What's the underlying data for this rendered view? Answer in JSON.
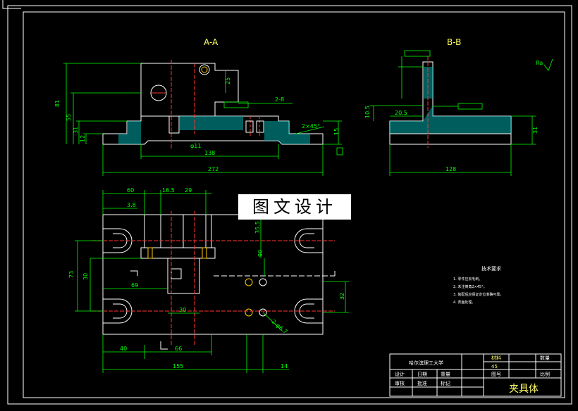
{
  "views": {
    "section_aa": "A-A",
    "section_bb": "B-B"
  },
  "dims_aa": {
    "d81": "81",
    "d55": "55",
    "d31": "31",
    "d12": "12",
    "d25": "25",
    "d15": "15",
    "d138": "138",
    "d272": "272",
    "phi11": "φ11",
    "chamfer": "2×45°",
    "holes": "2-8"
  },
  "dims_bb": {
    "d105": "10.5",
    "d205": "20.5",
    "d31": "31",
    "d128": "128",
    "ra": "Ra"
  },
  "dims_plan": {
    "d60": "60",
    "d165": "16.5",
    "d29": "29",
    "d38": "3.8",
    "d355": "35.5",
    "d90": "90",
    "d73": "73",
    "d30a": "30",
    "d69": "69",
    "d30b": "30",
    "d32": "32",
    "d40": "40",
    "d66": "66",
    "d155": "155",
    "d14": "14",
    "holes": "2-φ6.7"
  },
  "tech": {
    "title": "技术要求",
    "lines": [
      "1. 零件应去毛刺。",
      "2. 未注倒角2×45°。",
      "3. 装配后应保证定位准确可靠。",
      "4. 表面处理。"
    ]
  },
  "title_block": {
    "name": "夹具体",
    "material": "45",
    "header": "哈尔滨理工大学",
    "cells": [
      "设计",
      "日期",
      "审核",
      "批准",
      "材料",
      "数量",
      "比例",
      "图号",
      "重量",
      "标记"
    ]
  },
  "watermark": "图文设计",
  "colors": {
    "outline": "#ffffff",
    "dimension": "#00ff00",
    "center": "#ff3333",
    "hatch": "#00cccc",
    "label": "#ffff66"
  }
}
